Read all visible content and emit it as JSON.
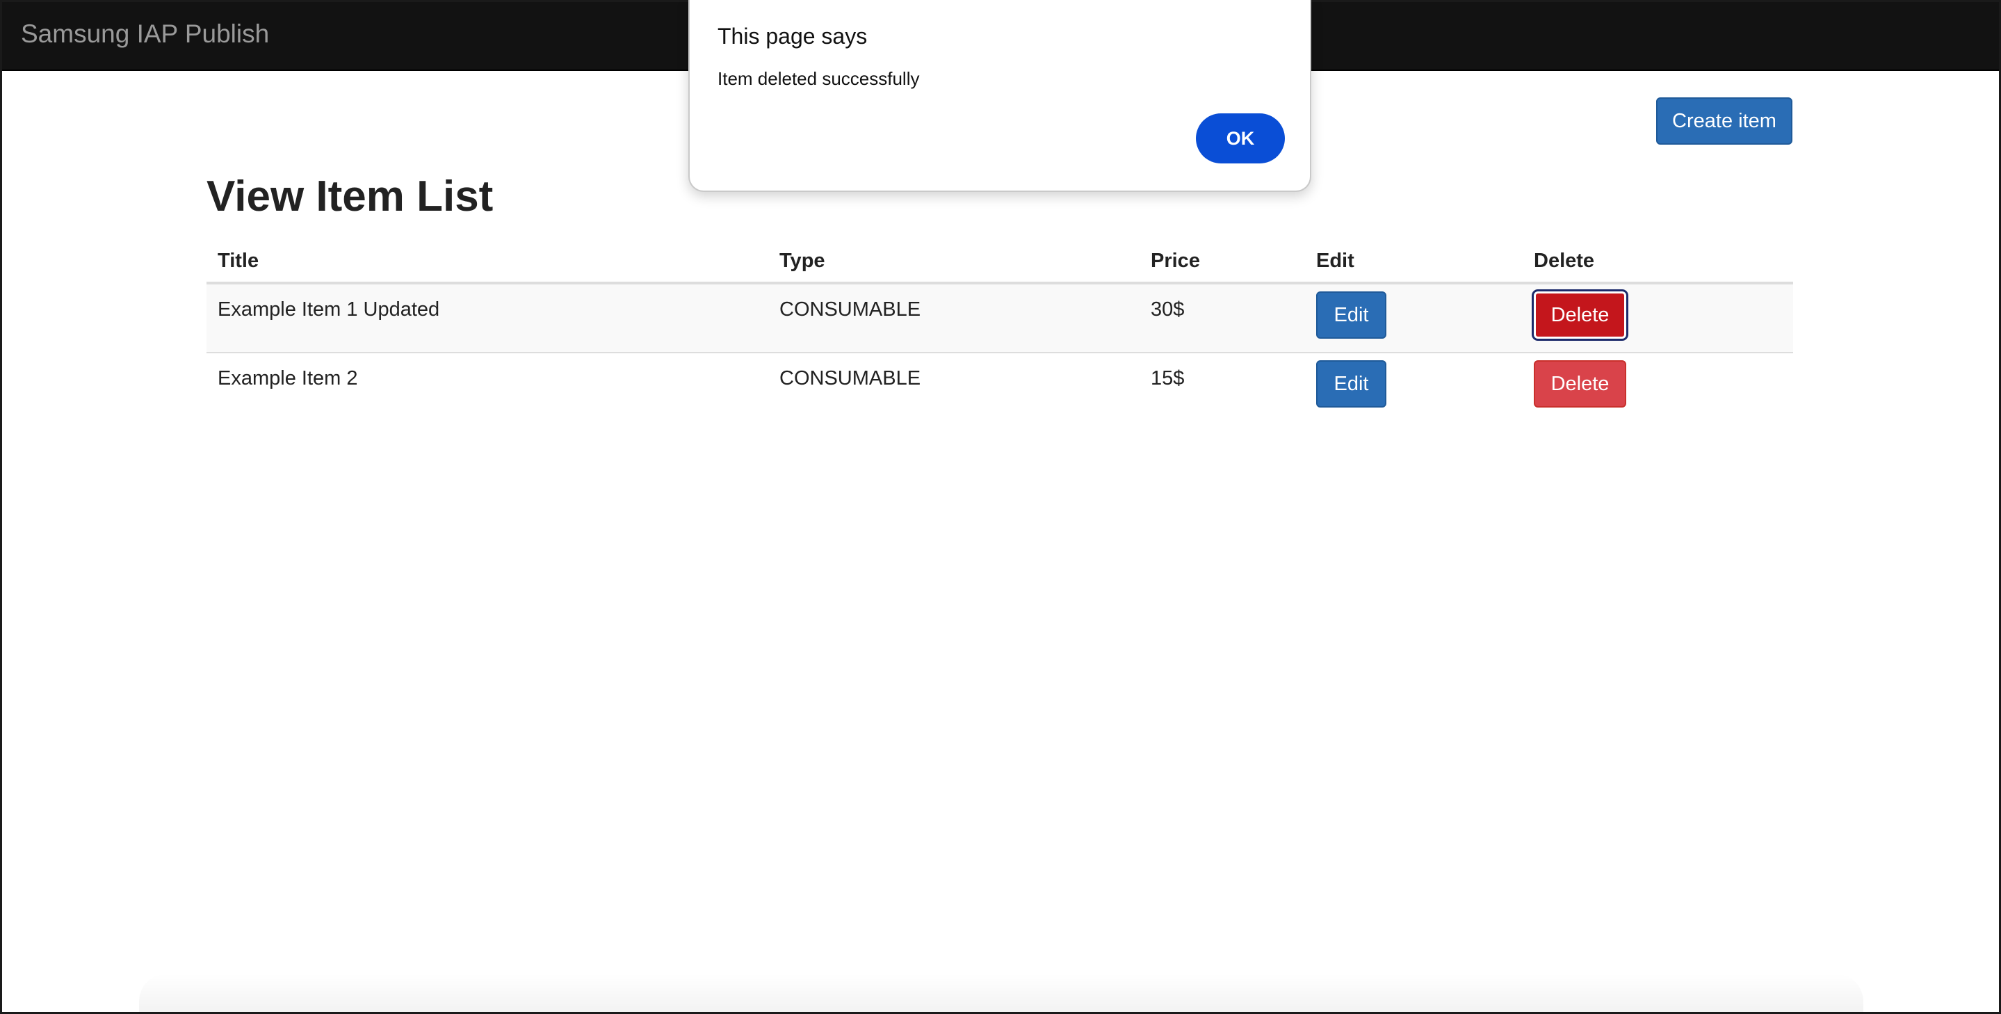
{
  "navbar": {
    "brand": "Samsung IAP Publish"
  },
  "toolbar": {
    "create_label": "Create item"
  },
  "main": {
    "title": "View Item List",
    "table": {
      "headers": [
        "Title",
        "Type",
        "Price",
        "Edit",
        "Delete"
      ],
      "rows": [
        {
          "title": "Example Item 1 Updated",
          "type": "CONSUMABLE",
          "price": "30$",
          "edit_label": "Edit",
          "delete_label": "Delete"
        },
        {
          "title": "Example Item 2",
          "type": "CONSUMABLE",
          "price": "15$",
          "edit_label": "Edit",
          "delete_label": "Delete"
        }
      ]
    }
  },
  "dialog": {
    "title": "This page says",
    "message": "Item deleted successfully",
    "ok_label": "OK"
  },
  "colors": {
    "navbar_bg": "#121212",
    "primary_button": "#2a6db5",
    "danger_button": "#d9434a",
    "danger_focused": "#c4161c",
    "dialog_ok": "#0a4ed6"
  }
}
